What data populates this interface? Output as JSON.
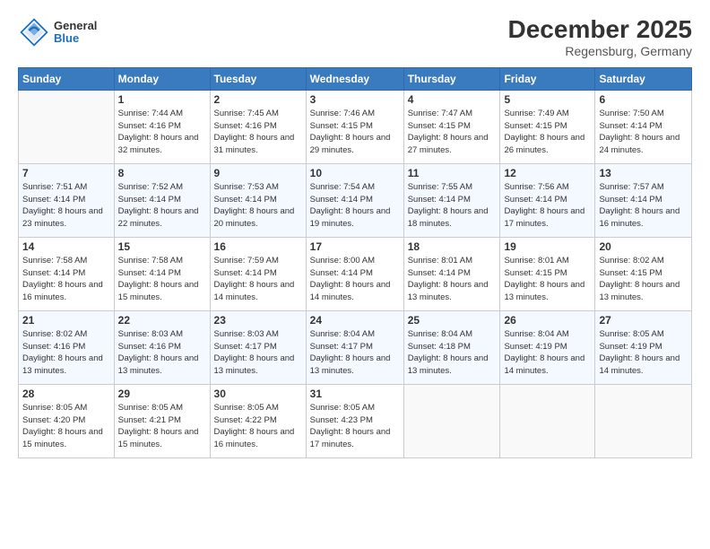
{
  "header": {
    "logo": {
      "general": "General",
      "blue": "Blue"
    },
    "title": "December 2025",
    "location": "Regensburg, Germany"
  },
  "columns": [
    "Sunday",
    "Monday",
    "Tuesday",
    "Wednesday",
    "Thursday",
    "Friday",
    "Saturday"
  ],
  "weeks": [
    [
      {
        "day": "",
        "sunrise": "",
        "sunset": "",
        "daylight": ""
      },
      {
        "day": "1",
        "sunrise": "Sunrise: 7:44 AM",
        "sunset": "Sunset: 4:16 PM",
        "daylight": "Daylight: 8 hours and 32 minutes."
      },
      {
        "day": "2",
        "sunrise": "Sunrise: 7:45 AM",
        "sunset": "Sunset: 4:16 PM",
        "daylight": "Daylight: 8 hours and 31 minutes."
      },
      {
        "day": "3",
        "sunrise": "Sunrise: 7:46 AM",
        "sunset": "Sunset: 4:15 PM",
        "daylight": "Daylight: 8 hours and 29 minutes."
      },
      {
        "day": "4",
        "sunrise": "Sunrise: 7:47 AM",
        "sunset": "Sunset: 4:15 PM",
        "daylight": "Daylight: 8 hours and 27 minutes."
      },
      {
        "day": "5",
        "sunrise": "Sunrise: 7:49 AM",
        "sunset": "Sunset: 4:15 PM",
        "daylight": "Daylight: 8 hours and 26 minutes."
      },
      {
        "day": "6",
        "sunrise": "Sunrise: 7:50 AM",
        "sunset": "Sunset: 4:14 PM",
        "daylight": "Daylight: 8 hours and 24 minutes."
      }
    ],
    [
      {
        "day": "7",
        "sunrise": "Sunrise: 7:51 AM",
        "sunset": "Sunset: 4:14 PM",
        "daylight": "Daylight: 8 hours and 23 minutes."
      },
      {
        "day": "8",
        "sunrise": "Sunrise: 7:52 AM",
        "sunset": "Sunset: 4:14 PM",
        "daylight": "Daylight: 8 hours and 22 minutes."
      },
      {
        "day": "9",
        "sunrise": "Sunrise: 7:53 AM",
        "sunset": "Sunset: 4:14 PM",
        "daylight": "Daylight: 8 hours and 20 minutes."
      },
      {
        "day": "10",
        "sunrise": "Sunrise: 7:54 AM",
        "sunset": "Sunset: 4:14 PM",
        "daylight": "Daylight: 8 hours and 19 minutes."
      },
      {
        "day": "11",
        "sunrise": "Sunrise: 7:55 AM",
        "sunset": "Sunset: 4:14 PM",
        "daylight": "Daylight: 8 hours and 18 minutes."
      },
      {
        "day": "12",
        "sunrise": "Sunrise: 7:56 AM",
        "sunset": "Sunset: 4:14 PM",
        "daylight": "Daylight: 8 hours and 17 minutes."
      },
      {
        "day": "13",
        "sunrise": "Sunrise: 7:57 AM",
        "sunset": "Sunset: 4:14 PM",
        "daylight": "Daylight: 8 hours and 16 minutes."
      }
    ],
    [
      {
        "day": "14",
        "sunrise": "Sunrise: 7:58 AM",
        "sunset": "Sunset: 4:14 PM",
        "daylight": "Daylight: 8 hours and 16 minutes."
      },
      {
        "day": "15",
        "sunrise": "Sunrise: 7:58 AM",
        "sunset": "Sunset: 4:14 PM",
        "daylight": "Daylight: 8 hours and 15 minutes."
      },
      {
        "day": "16",
        "sunrise": "Sunrise: 7:59 AM",
        "sunset": "Sunset: 4:14 PM",
        "daylight": "Daylight: 8 hours and 14 minutes."
      },
      {
        "day": "17",
        "sunrise": "Sunrise: 8:00 AM",
        "sunset": "Sunset: 4:14 PM",
        "daylight": "Daylight: 8 hours and 14 minutes."
      },
      {
        "day": "18",
        "sunrise": "Sunrise: 8:01 AM",
        "sunset": "Sunset: 4:14 PM",
        "daylight": "Daylight: 8 hours and 13 minutes."
      },
      {
        "day": "19",
        "sunrise": "Sunrise: 8:01 AM",
        "sunset": "Sunset: 4:15 PM",
        "daylight": "Daylight: 8 hours and 13 minutes."
      },
      {
        "day": "20",
        "sunrise": "Sunrise: 8:02 AM",
        "sunset": "Sunset: 4:15 PM",
        "daylight": "Daylight: 8 hours and 13 minutes."
      }
    ],
    [
      {
        "day": "21",
        "sunrise": "Sunrise: 8:02 AM",
        "sunset": "Sunset: 4:16 PM",
        "daylight": "Daylight: 8 hours and 13 minutes."
      },
      {
        "day": "22",
        "sunrise": "Sunrise: 8:03 AM",
        "sunset": "Sunset: 4:16 PM",
        "daylight": "Daylight: 8 hours and 13 minutes."
      },
      {
        "day": "23",
        "sunrise": "Sunrise: 8:03 AM",
        "sunset": "Sunset: 4:17 PM",
        "daylight": "Daylight: 8 hours and 13 minutes."
      },
      {
        "day": "24",
        "sunrise": "Sunrise: 8:04 AM",
        "sunset": "Sunset: 4:17 PM",
        "daylight": "Daylight: 8 hours and 13 minutes."
      },
      {
        "day": "25",
        "sunrise": "Sunrise: 8:04 AM",
        "sunset": "Sunset: 4:18 PM",
        "daylight": "Daylight: 8 hours and 13 minutes."
      },
      {
        "day": "26",
        "sunrise": "Sunrise: 8:04 AM",
        "sunset": "Sunset: 4:19 PM",
        "daylight": "Daylight: 8 hours and 14 minutes."
      },
      {
        "day": "27",
        "sunrise": "Sunrise: 8:05 AM",
        "sunset": "Sunset: 4:19 PM",
        "daylight": "Daylight: 8 hours and 14 minutes."
      }
    ],
    [
      {
        "day": "28",
        "sunrise": "Sunrise: 8:05 AM",
        "sunset": "Sunset: 4:20 PM",
        "daylight": "Daylight: 8 hours and 15 minutes."
      },
      {
        "day": "29",
        "sunrise": "Sunrise: 8:05 AM",
        "sunset": "Sunset: 4:21 PM",
        "daylight": "Daylight: 8 hours and 15 minutes."
      },
      {
        "day": "30",
        "sunrise": "Sunrise: 8:05 AM",
        "sunset": "Sunset: 4:22 PM",
        "daylight": "Daylight: 8 hours and 16 minutes."
      },
      {
        "day": "31",
        "sunrise": "Sunrise: 8:05 AM",
        "sunset": "Sunset: 4:23 PM",
        "daylight": "Daylight: 8 hours and 17 minutes."
      },
      {
        "day": "",
        "sunrise": "",
        "sunset": "",
        "daylight": ""
      },
      {
        "day": "",
        "sunrise": "",
        "sunset": "",
        "daylight": ""
      },
      {
        "day": "",
        "sunrise": "",
        "sunset": "",
        "daylight": ""
      }
    ]
  ]
}
